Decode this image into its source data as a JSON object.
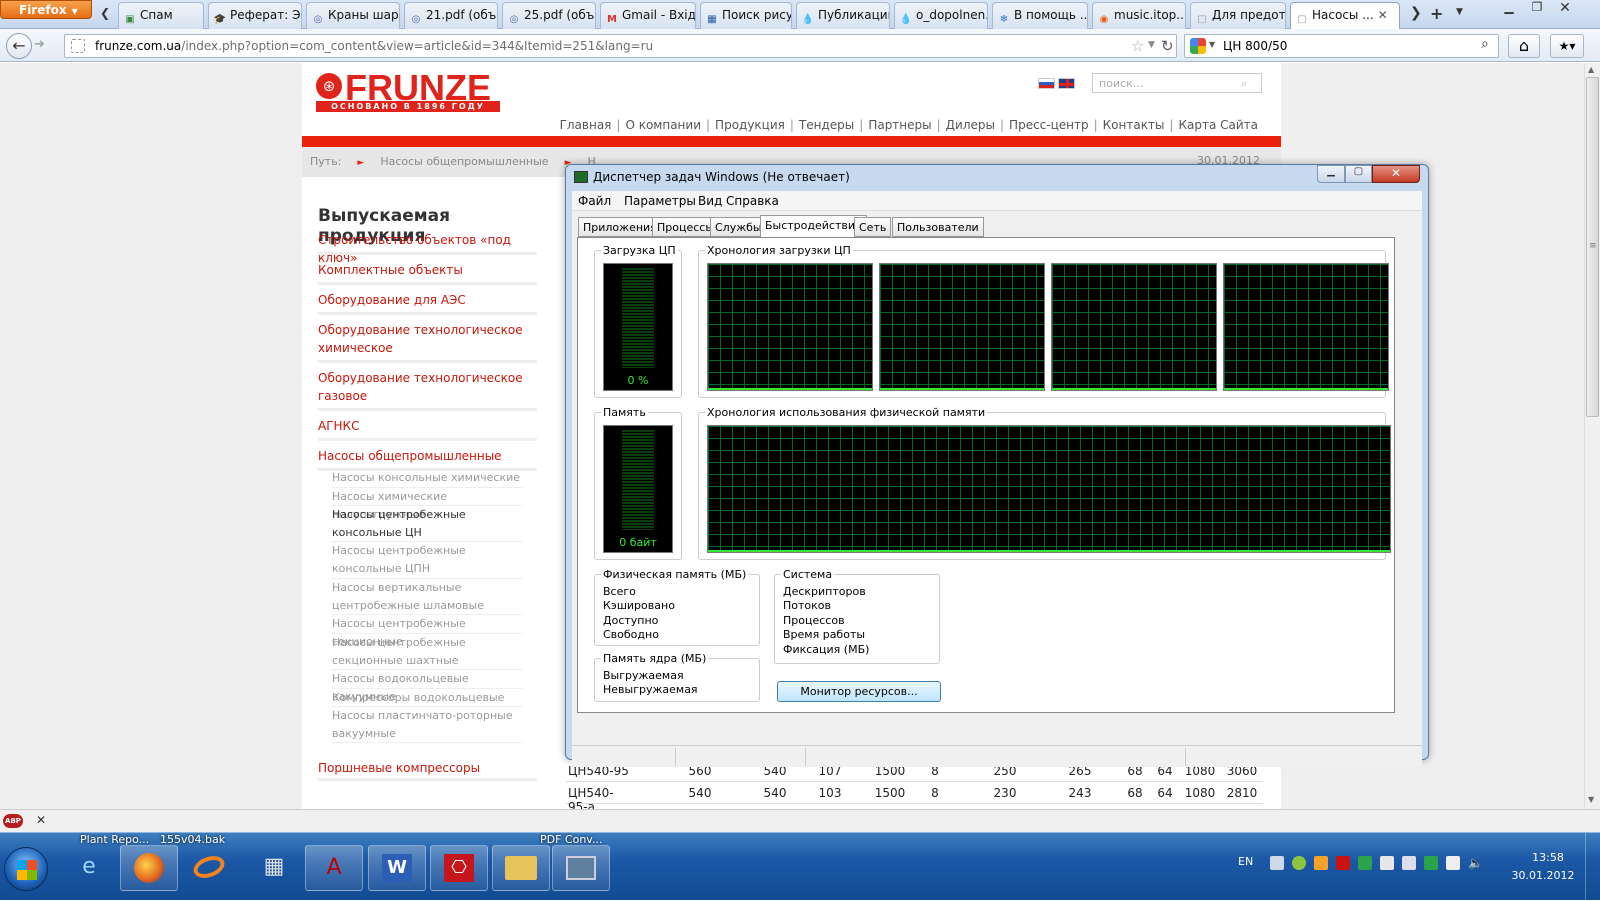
{
  "browser": {
    "menu_button": "Firefox",
    "tabs": [
      {
        "label": "Спам",
        "icon": "mail-icon",
        "color": "#3a8d3a",
        "glyph": "▣"
      },
      {
        "label": "Реферат: Э...",
        "icon": "graduation-cap-icon",
        "color": "#333333",
        "glyph": "🎓"
      },
      {
        "label": "Краны шар...",
        "icon": "globe-icon",
        "color": "#4a68a8",
        "glyph": "◎"
      },
      {
        "label": "21.pdf (объ...",
        "icon": "globe-icon",
        "color": "#4a68a8",
        "glyph": "◎"
      },
      {
        "label": "25.pdf (объ...",
        "icon": "globe-icon",
        "color": "#4a68a8",
        "glyph": "◎"
      },
      {
        "label": "Gmail - Вхід...",
        "icon": "gmail-icon",
        "color": "#d93025",
        "glyph": "M"
      },
      {
        "label": "Поиск рису...",
        "icon": "picture-icon",
        "color": "#1e5aa8",
        "glyph": "▦"
      },
      {
        "label": "Публикации",
        "icon": "drop-icon",
        "color": "#1b74c9",
        "glyph": "💧"
      },
      {
        "label": "o_dopolnen...",
        "icon": "drop-icon",
        "color": "#1b74c9",
        "glyph": "💧"
      },
      {
        "label": "В помощь ...",
        "icon": "snowflake-icon",
        "color": "#2a73c0",
        "glyph": "❄"
      },
      {
        "label": "music.itop....",
        "icon": "music-icon",
        "color": "#e8600c",
        "glyph": "◉"
      },
      {
        "label": "Для предот...",
        "icon": "blank-page-icon",
        "color": "#999999",
        "glyph": "▢"
      },
      {
        "label": "Насосы ...",
        "icon": "blank-page-icon",
        "color": "#999999",
        "glyph": "▢",
        "active": true
      }
    ],
    "url_host": "frunze.com.ua",
    "url_rest": "/index.php?option=com_content&view=article&id=344&Itemid=251&lang=ru",
    "search_value": "ЦН 800/50"
  },
  "site": {
    "logo_word": "FRUNZE",
    "logo_tagline": "ОСНОВАНО В 1896 ГОДУ",
    "search_placeholder": "поиск...",
    "nav": [
      "Главная",
      "О компании",
      "Продукция",
      "Тендеры",
      "Партнеры",
      "Дилеры",
      "Пресс-центр",
      "Контакты",
      "Карта Сайта"
    ],
    "crumb_label": "Путь:",
    "crumb_item": "Насосы общепромышленные",
    "crumb_item2": "Н",
    "date": "30.01.2012",
    "left_title": "Выпускаемая продукция",
    "menu": [
      "Строительство объектов «под ключ»",
      "Комплектные объекты",
      "Оборудование для АЭС",
      "Оборудование технологическое химическое",
      "Оборудование технологическое газовое",
      "АГНКС",
      "Насосы общепромышленные"
    ],
    "submenu": [
      "Насосы консольные химические",
      "Насосы химические полупогружные",
      "Насосы центробежные консольные ЦН",
      "Насосы центробежные консольные ЦПН",
      "Насосы вертикальные центробежные шламовые",
      "Насосы центробежные секционные",
      "Насосы центробежные секционные шахтные",
      "Насосы водокольцевые вакуумные",
      "Компрессоры водокольцевые",
      "Насосы пластинчато-роторные вакуумные"
    ],
    "menu_last": "Поршневые компрессоры",
    "table_rows": [
      [
        "ЦН540-95",
        "560",
        "540",
        "107",
        "1500",
        "8",
        "250",
        "265",
        "68",
        "64",
        "1080",
        "3060"
      ],
      [
        "ЦН540-95-а",
        "540",
        "540",
        "103",
        "1500",
        "8",
        "230",
        "243",
        "68",
        "64",
        "1080",
        "2810"
      ]
    ]
  },
  "taskmgr": {
    "title": "Диспетчер задач Windows (Не отвечает)",
    "menu": [
      "Файл",
      "Параметры",
      "Вид",
      "Справка"
    ],
    "tabs": [
      "Приложения",
      "Процессы",
      "Службы",
      "Быстродействие",
      "Сеть",
      "Пользователи"
    ],
    "active_tab": "Быстродействие",
    "cpu_label": "Загрузка ЦП",
    "cpu_value": "0 %",
    "cpu_history_label": "Хронология загрузки ЦП",
    "mem_label": "Память",
    "mem_value": "0 байт",
    "mem_history_label": "Хронология использования физической памяти",
    "physmem_title": "Физическая память (МБ)",
    "physmem_rows": [
      "Всего",
      "Кэшировано",
      "Доступно",
      "Свободно"
    ],
    "kernel_title": "Память ядра (МБ)",
    "kernel_rows": [
      "Выгружаемая",
      "Невыгружаемая"
    ],
    "system_title": "Система",
    "system_rows": [
      "Дескрипторов",
      "Потоков",
      "Процессов",
      "Время работы",
      "Фиксация (МБ)"
    ],
    "monitor_button": "Монитор ресурсов...",
    "graph_color": "#34e834"
  },
  "taskbar": {
    "labels": [
      "Plant Repo...",
      "155v04.bak",
      "PDF Conv..."
    ],
    "lang": "EN",
    "time": "13:58",
    "date": "30.01.2012"
  },
  "addon": {
    "abp_label": "ABP"
  }
}
